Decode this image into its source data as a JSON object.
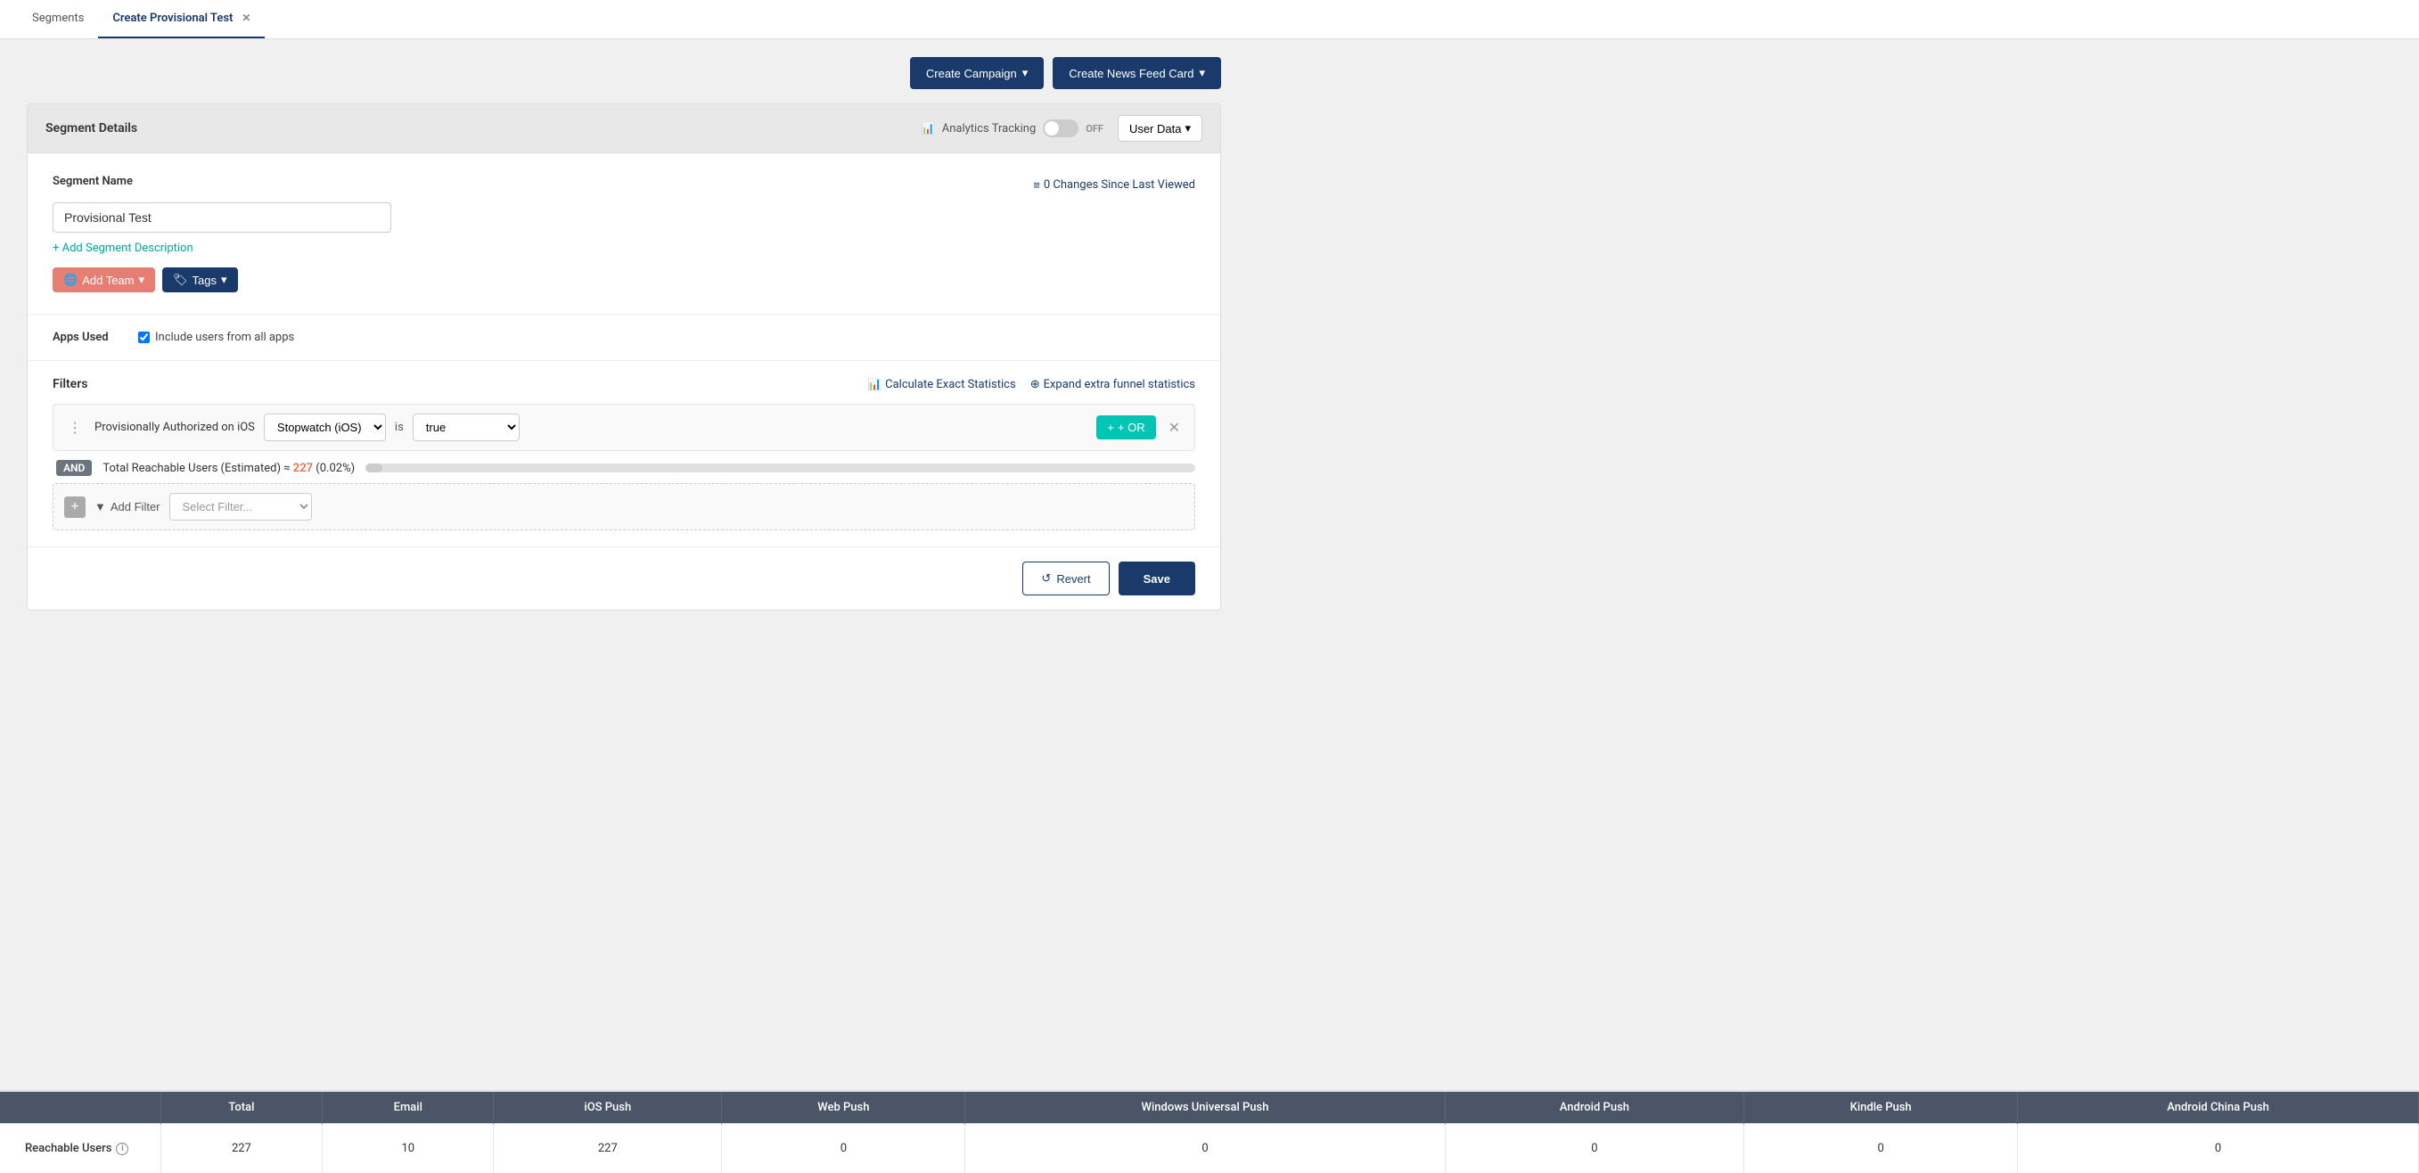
{
  "tabs": [
    {
      "id": "segments",
      "label": "Segments",
      "active": false,
      "closeable": false
    },
    {
      "id": "create-provisional-test",
      "label": "Create Provisional Test",
      "active": true,
      "closeable": true
    }
  ],
  "action_buttons": {
    "create_campaign": "Create Campaign",
    "create_news_feed_card": "Create News Feed Card"
  },
  "card": {
    "header": {
      "title": "Segment Details",
      "analytics_tracking_label": "Analytics Tracking",
      "toggle_state": "OFF",
      "user_data_label": "User Data"
    },
    "segment_name_label": "Segment Name",
    "segment_name_value": "Provisional Test",
    "changes_label": "0 Changes Since Last Viewed",
    "add_description_label": "+ Add Segment Description",
    "add_team_label": "Add Team",
    "tags_label": "Tags"
  },
  "apps_used": {
    "label": "Apps Used",
    "checkbox_label": "Include users from all apps"
  },
  "filters": {
    "label": "Filters",
    "calculate_link": "Calculate Exact Statistics",
    "expand_link": "Expand extra funnel statistics",
    "filter_row": {
      "text": "Provisionally Authorized on iOS",
      "app_select_value": "Stopwatch (iOS)",
      "is_text": "is",
      "value_select": "true"
    },
    "and_badge": "AND",
    "reachable_text": "Total Reachable Users (Estimated) ≈",
    "reachable_count": "227",
    "reachable_pct": "(0.02%)",
    "progress_pct": 2,
    "or_btn": "+ OR",
    "add_filter_label": "Add Filter",
    "select_filter_placeholder": "Select Filter..."
  },
  "footer": {
    "revert_label": "Revert",
    "save_label": "Save"
  },
  "bottom_table": {
    "headers": [
      "",
      "Total",
      "Email",
      "iOS Push",
      "Web Push",
      "Windows Universal Push",
      "Android Push",
      "Kindle Push",
      "Android China Push"
    ],
    "rows": [
      {
        "label": "Reachable Users",
        "cells": [
          "227",
          "10",
          "227",
          "0",
          "0",
          "0",
          "0",
          "0"
        ]
      }
    ]
  }
}
